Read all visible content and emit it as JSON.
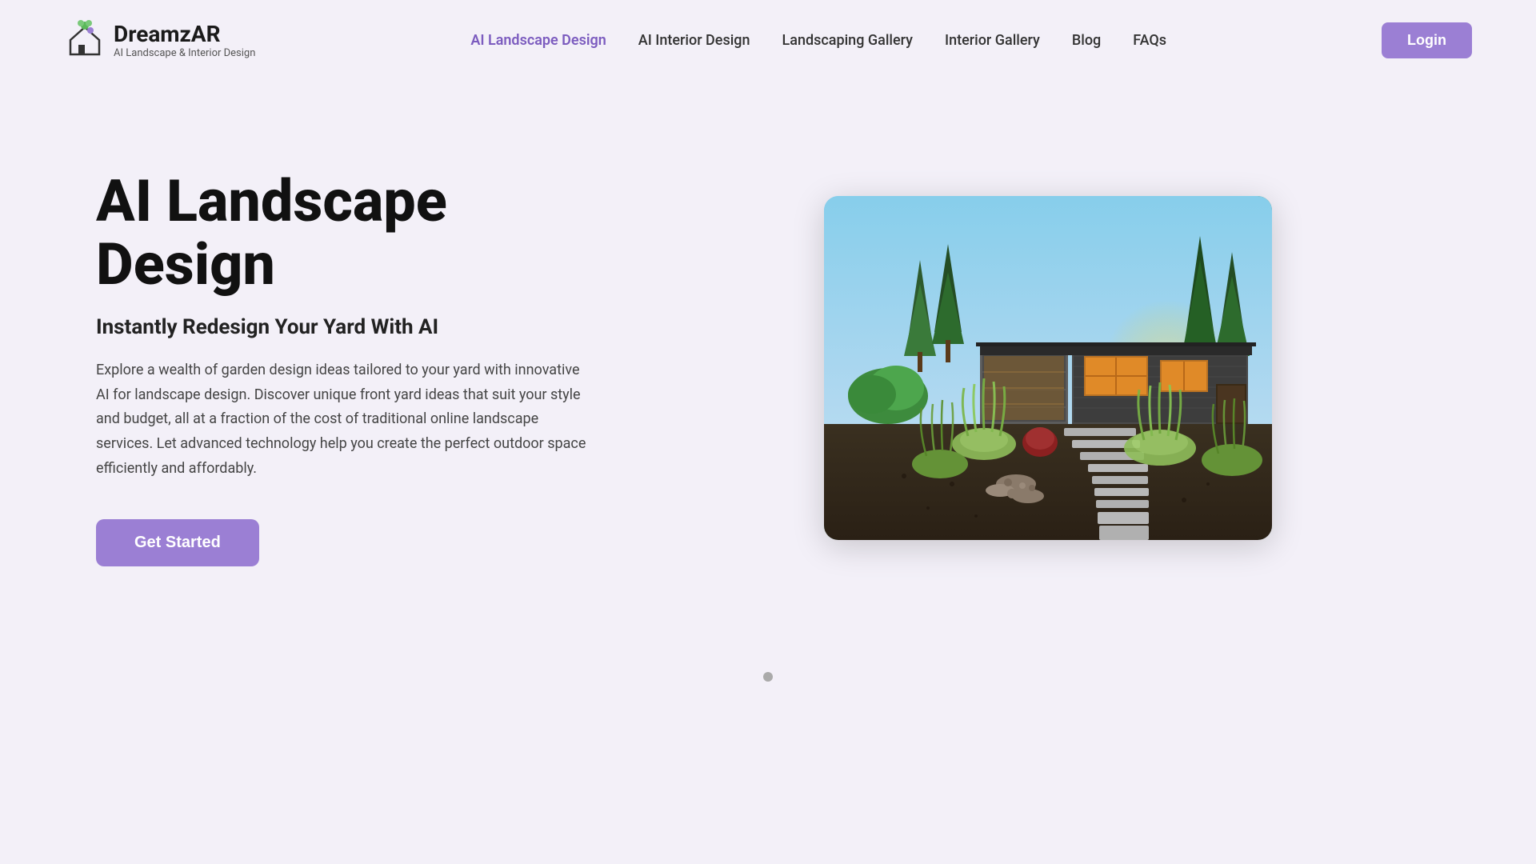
{
  "brand": {
    "name": "DreamzAR",
    "tagline": "AI Landscape & Interior Design"
  },
  "nav": {
    "links": [
      {
        "id": "ai-landscape",
        "label": "AI Landscape Design",
        "active": true
      },
      {
        "id": "ai-interior",
        "label": "AI Interior Design",
        "active": false
      },
      {
        "id": "landscaping-gallery",
        "label": "Landscaping Gallery",
        "active": false
      },
      {
        "id": "interior-gallery",
        "label": "Interior Gallery",
        "active": false
      },
      {
        "id": "blog",
        "label": "Blog",
        "active": false
      },
      {
        "id": "faqs",
        "label": "FAQs",
        "active": false
      }
    ],
    "login_label": "Login"
  },
  "hero": {
    "title": "AI Landscape Design",
    "subtitle": "Instantly Redesign Your Yard With AI",
    "description": "Explore a wealth of garden design ideas tailored to your yard with innovative AI for landscape design. Discover unique front yard ideas that suit your style and budget, all at a fraction of the cost of traditional online landscape services. Let advanced technology help you create the perfect outdoor space efficiently and affordably.",
    "cta_label": "Get Started"
  }
}
